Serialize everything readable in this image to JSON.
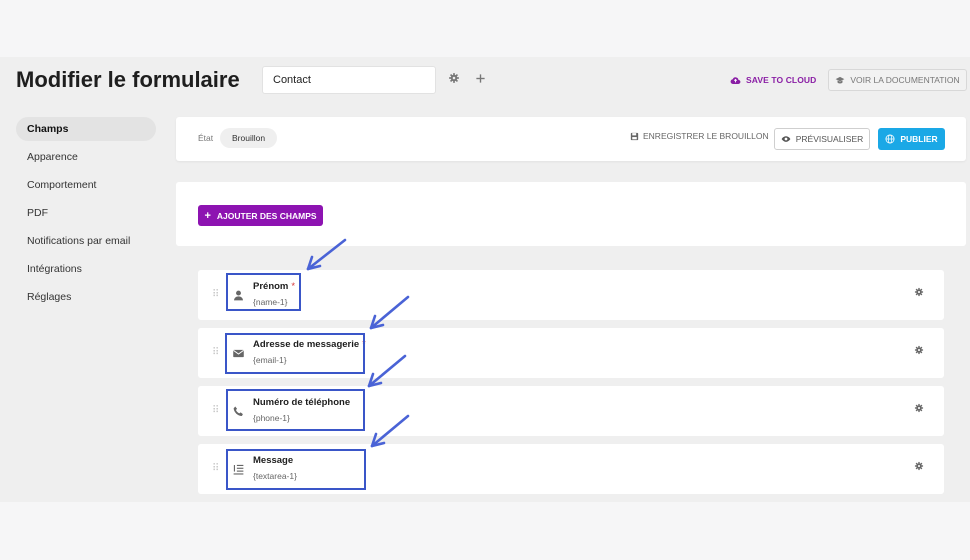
{
  "header": {
    "title": "Modifier le formulaire",
    "form_name": "Contact",
    "settings_icon": "gear-icon",
    "add_icon": "plus-icon",
    "save_cloud": "SAVE TO CLOUD",
    "docs": "VOIR LA DOCUMENTATION"
  },
  "sidebar": {
    "items": [
      {
        "label": "Champs",
        "active": true
      },
      {
        "label": "Apparence"
      },
      {
        "label": "Comportement"
      },
      {
        "label": "PDF"
      },
      {
        "label": "Notifications par email"
      },
      {
        "label": "Intégrations"
      },
      {
        "label": "Réglages"
      }
    ]
  },
  "status": {
    "label": "État",
    "value": "Brouillon",
    "save_draft": "ENREGISTRER LE BROUILLON",
    "preview": "PRÉVISUALISER",
    "publish": "PUBLIER"
  },
  "add_fields": {
    "label": "AJOUTER DES CHAMPS",
    "icon": "plus-icon"
  },
  "fields": [
    {
      "name": "Prénom",
      "required": "*",
      "id": "{name-1}",
      "icon": "user-icon"
    },
    {
      "name": "Adresse de messagerie",
      "required": "*",
      "id": "{email-1}",
      "icon": "envelope-icon"
    },
    {
      "name": "Numéro de téléphone",
      "required": "",
      "id": "{phone-1}",
      "icon": "phone-icon"
    },
    {
      "name": "Message",
      "required": "",
      "id": "{textarea-1}",
      "icon": "textarea-icon"
    }
  ],
  "colors": {
    "accent_purple": "#8d13b1",
    "publish_blue": "#1aa8e6",
    "annotation_blue": "#3a56c8",
    "required_red": "#d63638"
  }
}
